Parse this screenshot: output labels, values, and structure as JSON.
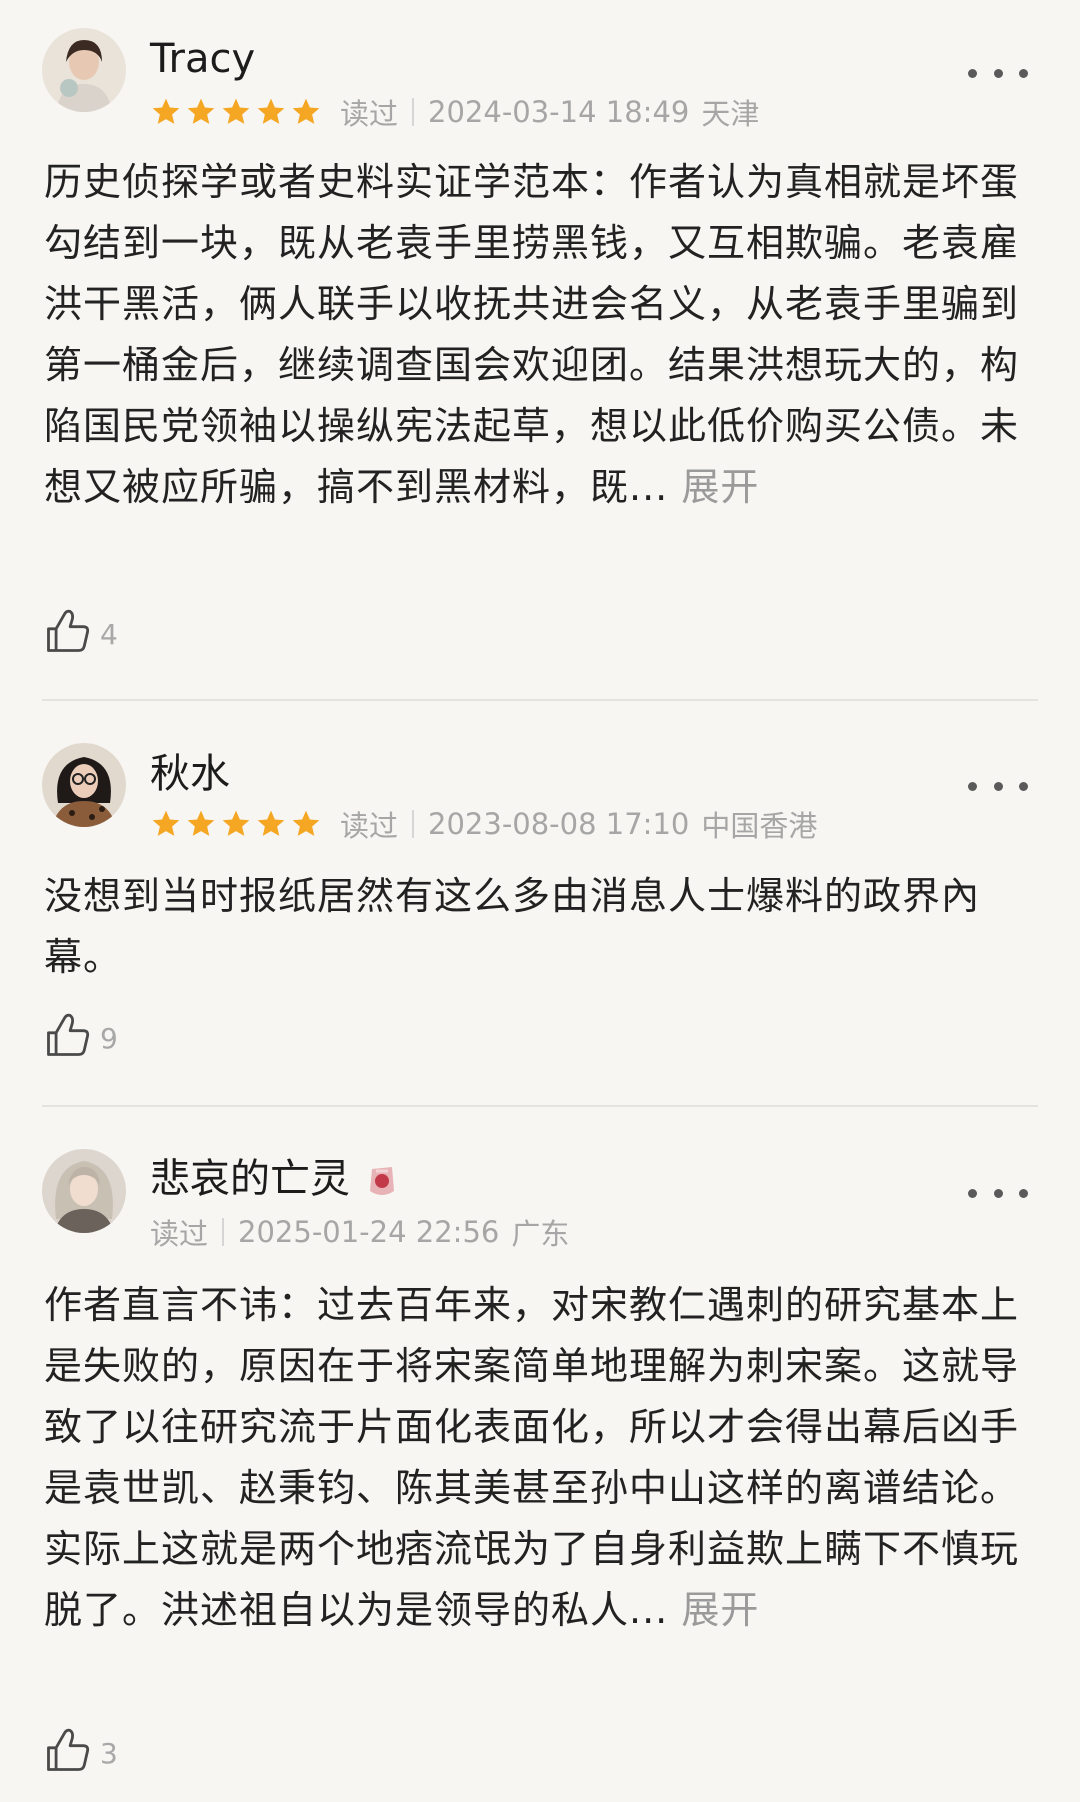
{
  "reviews": [
    {
      "name": "Tracy",
      "rating": 5,
      "read_label": "读过",
      "datetime": "2024-03-14 18:49",
      "location": "天津",
      "content": "历史侦探学或者史料实证学范本：作者认为真相就是坏蛋勾结到一块，既从老袁手里捞黑钱，又互相欺骗。老袁雇洪干黑活，俩人联手以收抚共进会名义，从老袁手里骗到第一桶金后，继续调查国会欢迎团。结果洪想玩大的，构陷国民党领袖以操纵宪法起草，想以此低价购买公债。未想又被应所骗，搞不到黑材料，既...",
      "expand_label": "展开",
      "likes": "4"
    },
    {
      "name": "秋水",
      "rating": 5,
      "read_label": "读过",
      "datetime": "2023-08-08 17:10",
      "location": "中国香港",
      "content": "没想到当时报纸居然有这么多由消息人士爆料的政界內幕。",
      "expand_label": "",
      "likes": "9"
    },
    {
      "name": "悲哀的亡灵",
      "rating": 0,
      "read_label": "读过",
      "datetime": "2025-01-24 22:56",
      "location": "广东",
      "content": "作者直言不讳：过去百年来，对宋教仁遇刺的研究基本上是失败的，原因在于将宋案简单地理解为刺宋案。这就导致了以往研究流于片面化表面化，所以才会得出幕后凶手是袁世凯、赵秉钧、陈其美甚至孙中山这样的离谱结论。实际上这就是两个地痞流氓为了自身利益欺上瞒下不慎玩脱了。洪述祖自以为是领导的私人...",
      "expand_label": "展开",
      "likes": "3"
    }
  ],
  "colors": {
    "background": "#f7f6f2",
    "star": "#f5a623",
    "meta_text": "#a6a6a6",
    "expand_text": "#9a9a9a"
  },
  "icons": {
    "star": "star-icon",
    "more": "more-dots-icon",
    "like": "thumbs-up-icon"
  }
}
